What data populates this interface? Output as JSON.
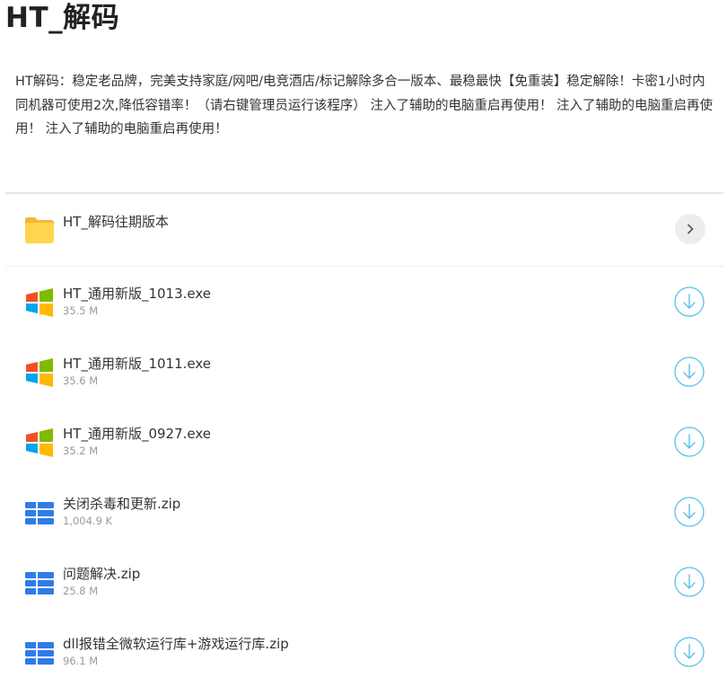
{
  "page": {
    "title": "HT_解码",
    "description": "HT解码：稳定老品牌，完美支持家庭/网吧/电竞酒店/标记解除多合一版本、最稳最快【免重装】稳定解除！卡密1小时内同机器可使用2次,降低容错率！（请右键管理员运行该程序） 注入了辅助的电脑重启再使用！ 注入了辅助的电脑重启再使用！ 注入了辅助的电脑重启再使用！"
  },
  "folder": {
    "name": "HT_解码往期版本",
    "icon": "folder-icon"
  },
  "files": [
    {
      "name": "HT_通用新版_1013.exe",
      "size": "35.5 M",
      "icon": "windows-icon"
    },
    {
      "name": "HT_通用新版_1011.exe",
      "size": "35.6 M",
      "icon": "windows-icon"
    },
    {
      "name": "HT_通用新版_0927.exe",
      "size": "35.2 M",
      "icon": "windows-icon"
    },
    {
      "name": "关闭杀毒和更新.zip",
      "size": "1,004.9 K",
      "icon": "archive-icon"
    },
    {
      "name": "问题解决.zip",
      "size": "25.8 M",
      "icon": "archive-icon"
    },
    {
      "name": "dll报错全微软运行库+游戏运行库.zip",
      "size": "96.1 M",
      "icon": "archive-icon"
    }
  ],
  "colors": {
    "download_accent": "#5bc0e8",
    "folder_yellow": "#ffd54f",
    "archive_blue": "#2f7be8",
    "win_red": "#f25022",
    "win_green": "#7fba00",
    "win_blue": "#00a4ef",
    "win_yellow": "#ffb900"
  }
}
